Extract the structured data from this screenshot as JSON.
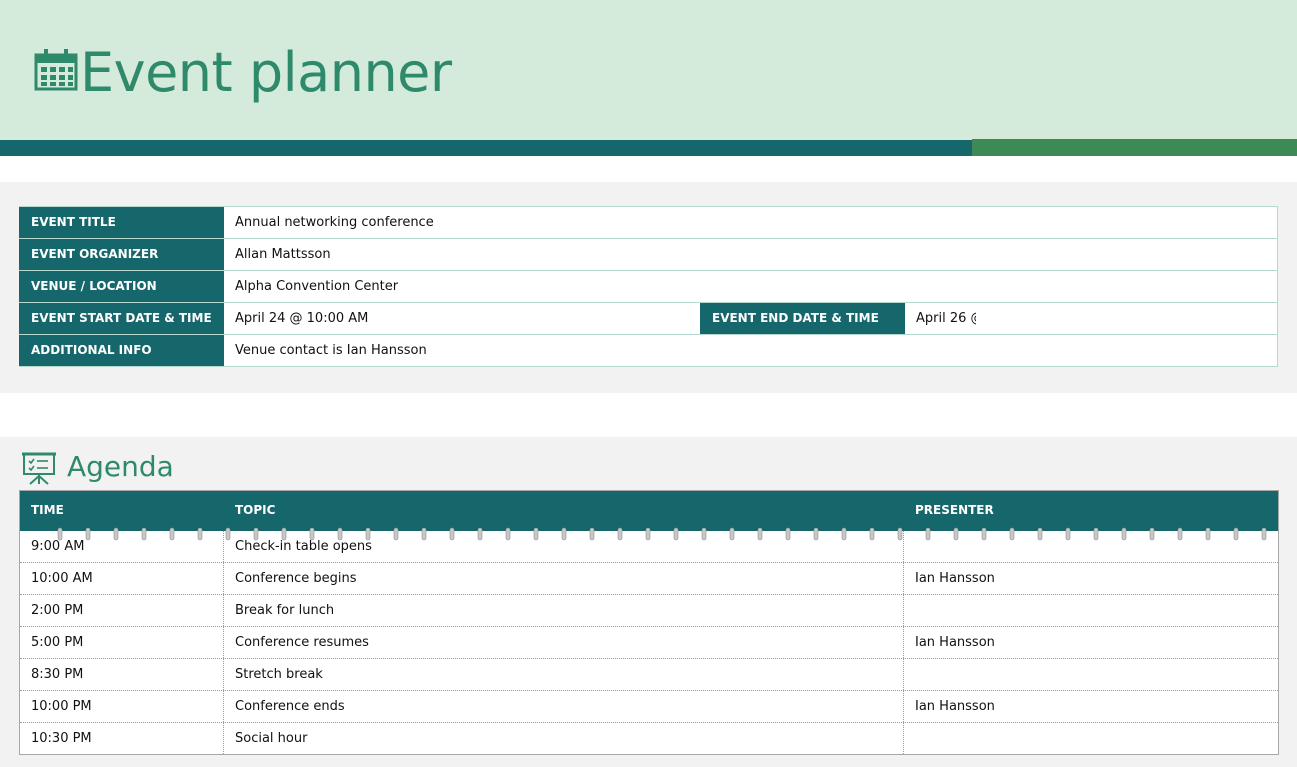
{
  "header": {
    "title": "Event planner",
    "icon": "calendar-icon",
    "colors": {
      "background": "#d4ebdc",
      "title": "#2f8a6c",
      "bar_teal": "#15676c",
      "bar_green": "#3e8a57"
    }
  },
  "event_info": {
    "title_label": "EVENT TITLE",
    "title_value": "Annual networking conference",
    "organizer_label": "EVENT ORGANIZER",
    "organizer_value": "Allan Mattsson",
    "venue_label": "VENUE / LOCATION",
    "venue_value": "Alpha Convention Center",
    "start_label": "EVENT START DATE & TIME",
    "start_value": "April 24 @ 10:00 AM",
    "end_label": "EVENT END DATE & TIME",
    "end_value": "April 26 @",
    "additional_label": "ADDITIONAL INFO",
    "additional_value": "Venue contact is Ian Hansson"
  },
  "agenda": {
    "title": "Agenda",
    "icon": "presentation-board-icon",
    "columns": {
      "time": "TIME",
      "topic": "TOPIC",
      "presenter": "PRESENTER"
    },
    "rows": [
      {
        "time": "9:00 AM",
        "topic": "Check-in table opens",
        "presenter": ""
      },
      {
        "time": "10:00 AM",
        "topic": "Conference begins",
        "presenter": "Ian Hansson"
      },
      {
        "time": "2:00 PM",
        "topic": "Break for lunch",
        "presenter": ""
      },
      {
        "time": "5:00 PM",
        "topic": "Conference resumes",
        "presenter": "Ian Hansson"
      },
      {
        "time": "8:30 PM",
        "topic": "Stretch break",
        "presenter": ""
      },
      {
        "time": "10:00 PM",
        "topic": "Conference ends",
        "presenter": "Ian Hansson"
      },
      {
        "time": "10:30 PM",
        "topic": "Social hour",
        "presenter": ""
      }
    ]
  }
}
